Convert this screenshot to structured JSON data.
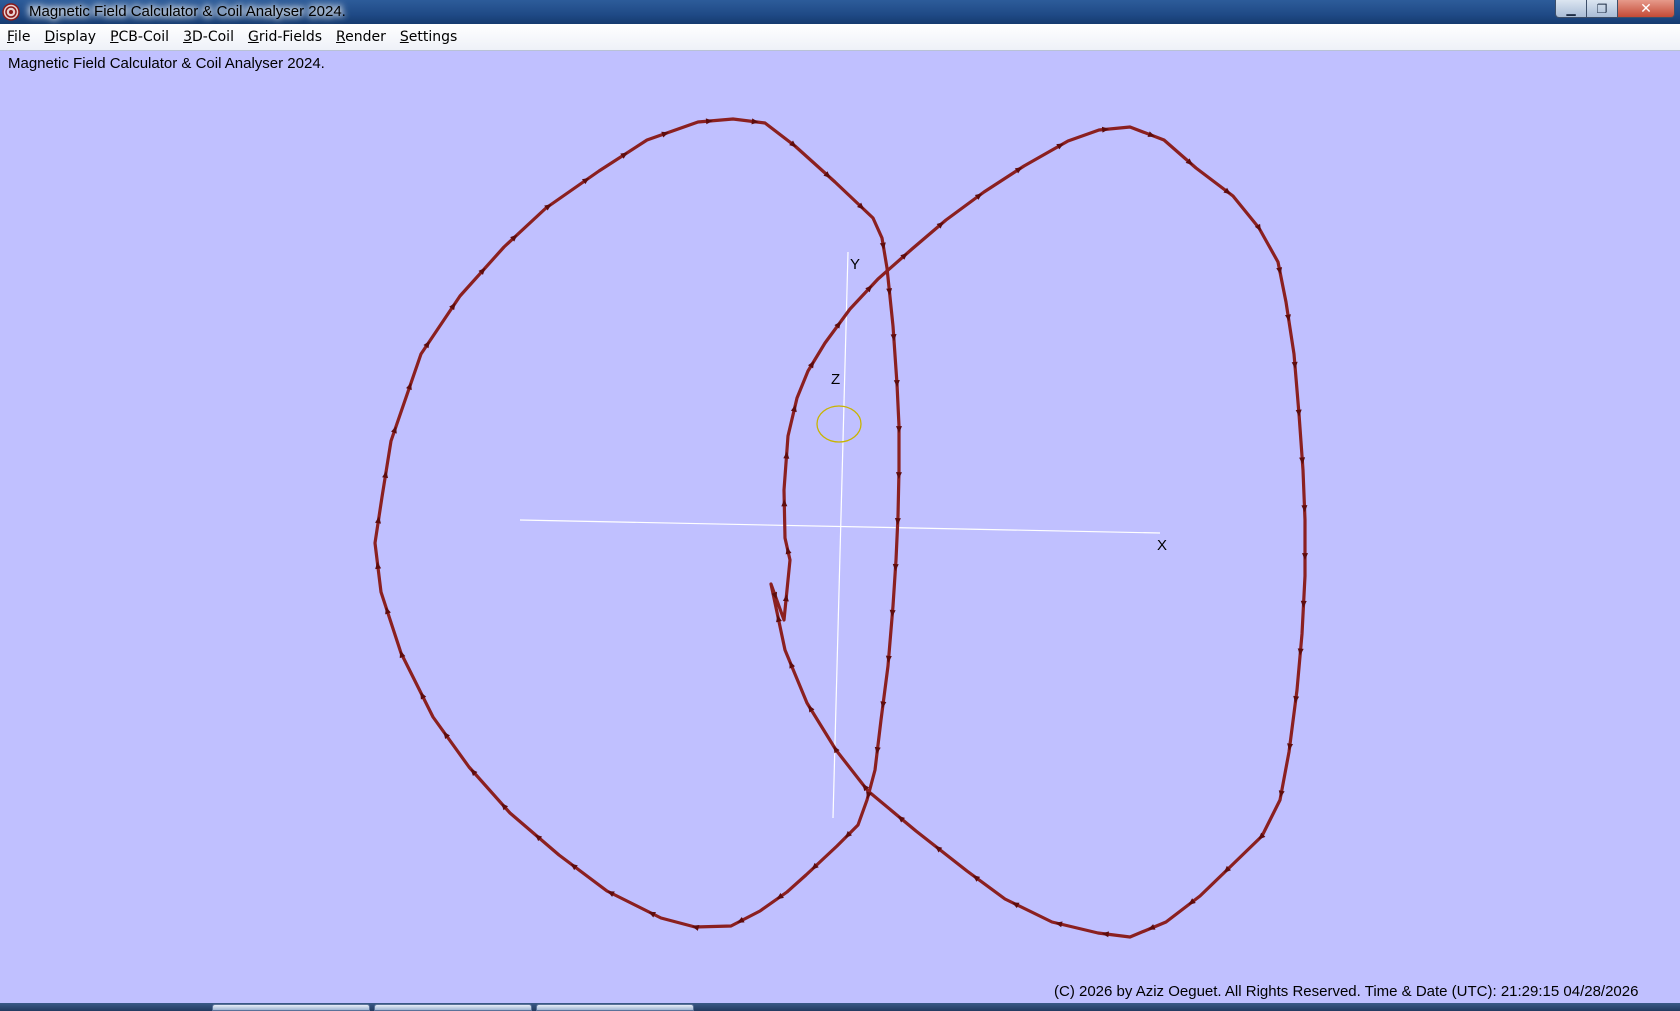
{
  "window": {
    "title": "Magnetic Field Calculator & Coil Analyser 2024.",
    "min_icon": "minimize-icon",
    "max_icon": "maximize-icon",
    "close_icon": "close-icon"
  },
  "menu": {
    "items": [
      {
        "mnemonic": "F",
        "rest": "ile"
      },
      {
        "mnemonic": "D",
        "rest": "isplay"
      },
      {
        "mnemonic": "P",
        "rest": "CB-Coil"
      },
      {
        "mnemonic": "3",
        "rest": "D-Coil"
      },
      {
        "mnemonic": "G",
        "rest": "rid-Fields"
      },
      {
        "mnemonic": "R",
        "rest": "ender"
      },
      {
        "mnemonic": "S",
        "rest": "ettings"
      }
    ]
  },
  "banner": "Magnetic Field Calculator & Coil Analyser 2024.",
  "axes": {
    "x_label": "X",
    "y_label": "Y",
    "z_label": "Z"
  },
  "colors": {
    "background": "#c0c0ff",
    "coil": "#8b2020",
    "axis": "#ffffff",
    "origin_marker": "#c8b400"
  },
  "footer": "(C) 2026  by Aziz Oeguet. All Rights Reserved.  Time & Date (UTC): 21:29:15  04/28/2026"
}
